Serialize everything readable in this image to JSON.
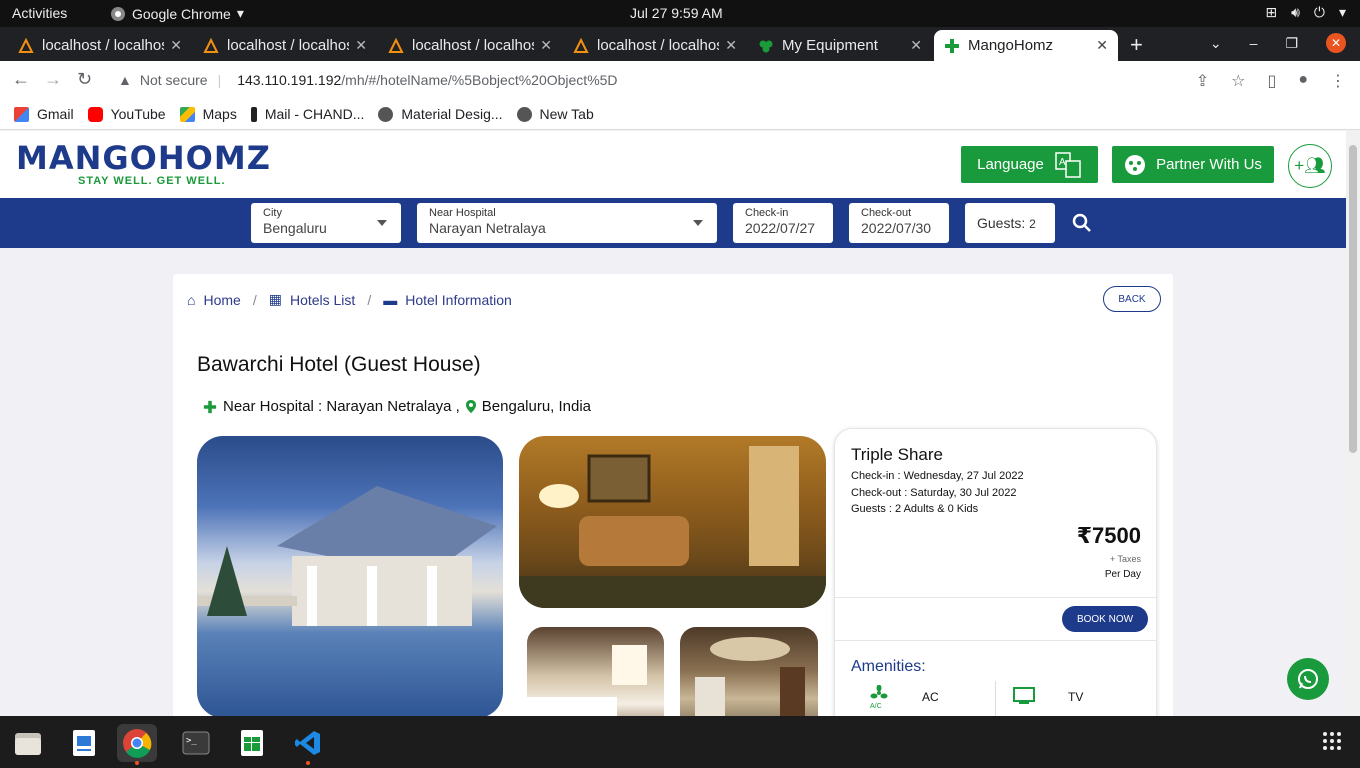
{
  "system": {
    "activities": "Activities",
    "app_name": "Google Chrome",
    "clock": "Jul 27   9:59 AM"
  },
  "tabs": [
    {
      "title": "localhost / localhost",
      "icon": "phpmyadmin-icon"
    },
    {
      "title": "localhost / localhost",
      "icon": "phpmyadmin-icon"
    },
    {
      "title": "localhost / localhost",
      "icon": "phpmyadmin-icon"
    },
    {
      "title": "localhost / localhost",
      "icon": "phpmyadmin-icon"
    },
    {
      "title": "My Equipment",
      "icon": "clover-icon"
    },
    {
      "title": "MangoHomz",
      "icon": "medical-cross-icon",
      "active": true
    }
  ],
  "address": {
    "security": "Not secure",
    "host": "143.110.191.192",
    "path": "/mh/#/hotelName/%5Bobject%20Object%5D"
  },
  "bookmarks": [
    {
      "label": "Gmail",
      "icon": "gmail-icon"
    },
    {
      "label": "YouTube",
      "icon": "youtube-icon"
    },
    {
      "label": "Maps",
      "icon": "maps-icon"
    },
    {
      "label": "Mail - CHAND...",
      "icon": "mail-icon"
    },
    {
      "label": "Material Desig...",
      "icon": "globe-icon"
    },
    {
      "label": "New Tab",
      "icon": "globe-icon"
    }
  ],
  "site": {
    "logo": "MANGOHOMZ",
    "tagline": "STAY WELL. GET WELL.",
    "language_button": "Language",
    "partner_button": "Partner With Us"
  },
  "search": {
    "city_label": "City",
    "city_value": "Bengaluru",
    "hospital_label": "Near Hospital",
    "hospital_value": "Narayan Netralaya",
    "checkin_label": "Check-in",
    "checkin_value": "2022/07/27",
    "checkout_label": "Check-out",
    "checkout_value": "2022/07/30",
    "guests_label": "Guests:",
    "guests_value": "2"
  },
  "breadcrumb": {
    "home": "Home",
    "hotels": "Hotels List",
    "info": "Hotel Information",
    "sep": "/"
  },
  "back_button": "BACK",
  "hotel": {
    "name": "Bawarchi Hotel (Guest House)",
    "near_hospital": "Near Hospital : Narayan Netralaya ,",
    "location": "Bengaluru, India"
  },
  "room": {
    "type": "Triple Share",
    "checkin": "Check-in : Wednesday, 27 Jul 2022",
    "checkout": "Check-out : Saturday, 30 Jul 2022",
    "guests": "Guests : 2 Adults & 0 Kids",
    "price": "₹7500",
    "taxes": "+ Taxes",
    "per_day": "Per Day",
    "book_button": "BOOK NOW",
    "amenities_title": "Amenities:",
    "amenities": [
      {
        "label": "AC",
        "icon": "ac-icon"
      },
      {
        "label": "TV",
        "icon": "tv-icon"
      }
    ]
  },
  "colors": {
    "brand_blue": "#1e3a8a",
    "brand_green": "#199a3c"
  }
}
